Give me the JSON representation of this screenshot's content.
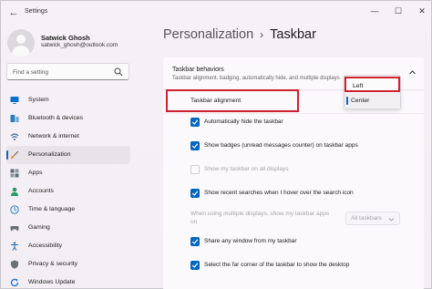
{
  "window": {
    "title": "Settings",
    "back_glyph": "←",
    "minimize_glyph": "—",
    "maximize_glyph": "☐",
    "close_glyph": "✕"
  },
  "profile": {
    "name": "Satwick Ghosh",
    "email": "satwick_ghosh@outlook.com"
  },
  "search": {
    "placeholder": "Find a setting"
  },
  "nav": {
    "items": [
      {
        "label": "System",
        "icon": "monitor-icon",
        "color": "#0a6fc9"
      },
      {
        "label": "Bluetooth & devices",
        "icon": "bluetooth-devices-icon",
        "color": "#2c7fb8"
      },
      {
        "label": "Network & internet",
        "icon": "network-icon",
        "color": "#3a6ea5"
      },
      {
        "label": "Personalization",
        "icon": "brush-icon",
        "color": "#d98b2b"
      },
      {
        "label": "Apps",
        "icon": "apps-icon",
        "color": "#5c6a78"
      },
      {
        "label": "Accounts",
        "icon": "person-icon",
        "color": "#2e9a6a"
      },
      {
        "label": "Time & language",
        "icon": "globe-clock-icon",
        "color": "#2b7fc0"
      },
      {
        "label": "Gaming",
        "icon": "gamepad-icon",
        "color": "#6b6f77"
      },
      {
        "label": "Accessibility",
        "icon": "accessibility-icon",
        "color": "#2a72b5"
      },
      {
        "label": "Privacy & security",
        "icon": "shield-icon",
        "color": "#6a6f78"
      },
      {
        "label": "Windows Update",
        "icon": "update-icon",
        "color": "#1f73c9"
      }
    ],
    "selected_index": 3
  },
  "breadcrumb": {
    "parent": "Personalization",
    "separator": "›",
    "current": "Taskbar"
  },
  "behaviors": {
    "title": "Taskbar behaviors",
    "description": "Taskbar alignment, badging, automatically hide, and multiple displays",
    "alignment_label": "Taskbar alignment",
    "alignment_options": [
      "Left",
      "Center"
    ],
    "alignment_selected": "Center",
    "checkboxes": [
      {
        "label": "Automatically hide the taskbar",
        "checked": true,
        "disabled": false
      },
      {
        "label": "Show badges (unread messages counter) on taskbar apps",
        "checked": true,
        "disabled": false
      },
      {
        "label": "Show my taskbar on all displays",
        "checked": false,
        "disabled": true
      },
      {
        "label": "Show recent searches when I hover over the search icon",
        "checked": true,
        "disabled": false
      },
      {
        "label": "Share any window from my taskbar",
        "checked": true,
        "disabled": false
      },
      {
        "label": "Select the far corner of the taskbar to show the desktop",
        "checked": true,
        "disabled": false
      }
    ],
    "multi_display_label": "When using multiple displays, show my taskbar apps on",
    "multi_display_value": "All taskbars"
  },
  "colors": {
    "accent": "#0067c0",
    "highlight_red": "#d0212e"
  }
}
